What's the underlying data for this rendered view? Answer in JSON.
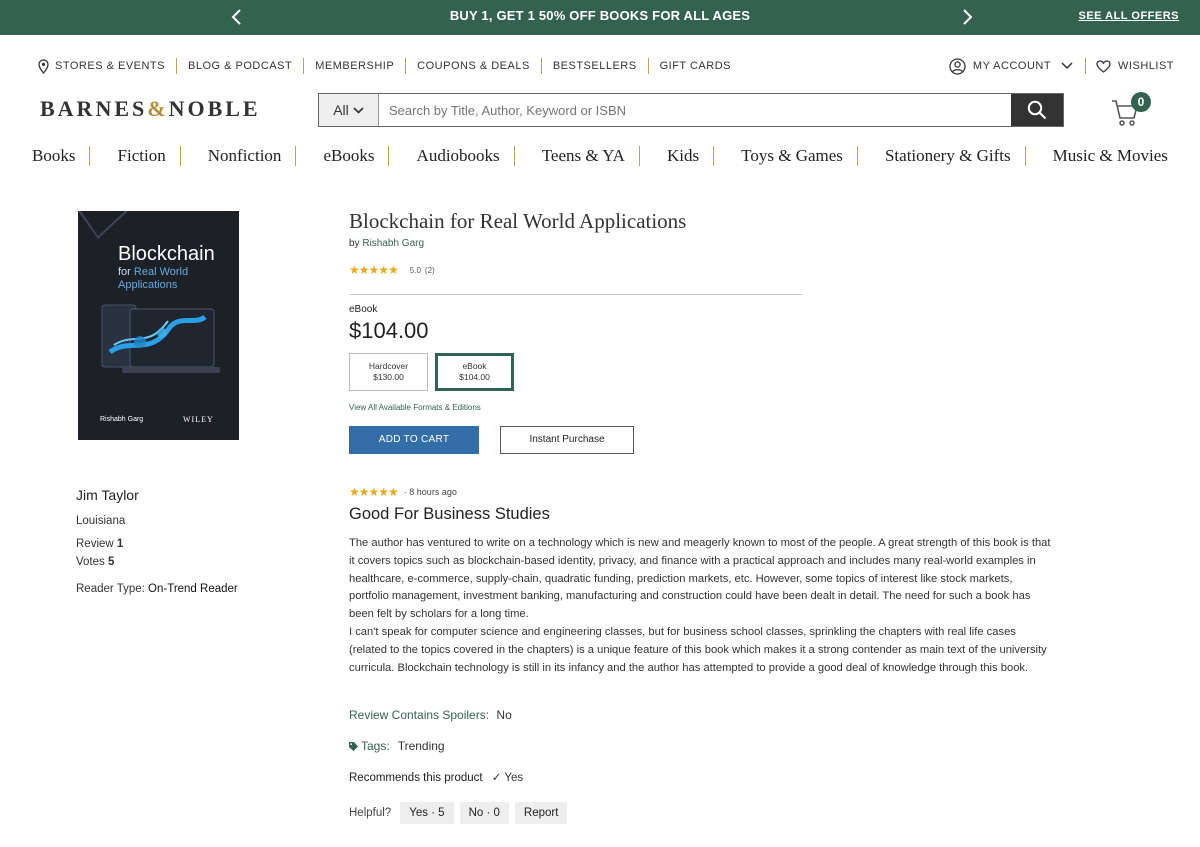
{
  "promo": {
    "message": "BUY 1, GET 1 50% OFF BOOKS FOR ALL AGES",
    "see_all": "SEE ALL OFFERS"
  },
  "utility_nav": {
    "stores": "STORES & EVENTS",
    "blog": "BLOG & PODCAST",
    "membership": "MEMBERSHIP",
    "coupons": "COUPONS & DEALS",
    "bestsellers": "BESTSELLERS",
    "gift_cards": "GIFT CARDS",
    "account": "MY ACCOUNT",
    "wishlist": "WISHLIST"
  },
  "logo": {
    "left": "BARNES",
    "amp": "&",
    "right": "NOBLE"
  },
  "search": {
    "scope": "All",
    "placeholder": "Search by Title, Author, Keyword or ISBN"
  },
  "cart": {
    "count": "0"
  },
  "categories": [
    "Books",
    "Fiction",
    "Nonfiction",
    "eBooks",
    "Audiobooks",
    "Teens & YA",
    "Kids",
    "Toys & Games",
    "Stationery & Gifts",
    "Music & Movies"
  ],
  "cover": {
    "title_line1": "Blockchain",
    "title_for": "for",
    "title_highlight": "Real World Applications",
    "author": "Rishabh Garg",
    "publisher": "WILEY"
  },
  "product": {
    "title": "Blockchain for Real World Applications",
    "by": "by",
    "author": "Rishabh Garg",
    "stars": "★★★★★",
    "score": "5.0",
    "review_count": "(2)",
    "format_label": "eBook",
    "price": "$104.00",
    "formats": [
      {
        "name": "Hardcover",
        "price": "$130.00"
      },
      {
        "name": "eBook",
        "price": "$104.00"
      }
    ],
    "view_all": "View All Available Formats & Editions",
    "add_to_cart": "ADD TO CART",
    "instant_purchase": "Instant Purchase"
  },
  "reviewer": {
    "name": "Jim Taylor",
    "location": "Louisiana",
    "review_label": "Review",
    "review_count": "1",
    "votes_label": "Votes",
    "votes_count": "5",
    "reader_type_label": "Reader Type:",
    "reader_type": "On-Trend Reader"
  },
  "review": {
    "stars": "★★★★★",
    "time_ago": "· 8 hours ago",
    "title": "Good For Business Studies",
    "paragraph1": "The author has ventured to write on a technology which is new and meagerly known to most of the people. A great strength of this book is that it covers topics such as blockchain-based identity, privacy, and finance with a practical approach and includes many real-world examples in healthcare, e-commerce, supply-chain, quadratic funding, prediction markets, etc. However, some topics of interest like stock markets, portfolio management, investment banking, manufacturing and construction could have been dealt in detail. The need for such a book has been felt by scholars for a long time.",
    "paragraph2": "I can't speak for computer science and engineering classes, but for business school classes, sprinkling the chapters with real life cases (related to the topics covered in the chapters) is a unique feature of this book which makes it a strong contender as main text of the university curricula. Blockchain technology is still in its infancy and the author has attempted to provide a good deal of knowledge through this book.",
    "spoilers_label": "Review Contains Spoilers:",
    "spoilers_value": "No",
    "tags_label": "Tags:",
    "tags_value": "Trending",
    "recommends_label": "Recommends this product",
    "recommends_value": "✓ Yes",
    "helpful_label": "Helpful?",
    "helpful_yes": "Yes · 5",
    "helpful_no": "No · 0",
    "report": "Report"
  },
  "colors": {
    "brand_green": "#346250",
    "button_blue": "#346ea8",
    "star_gold": "#e9a81e"
  }
}
